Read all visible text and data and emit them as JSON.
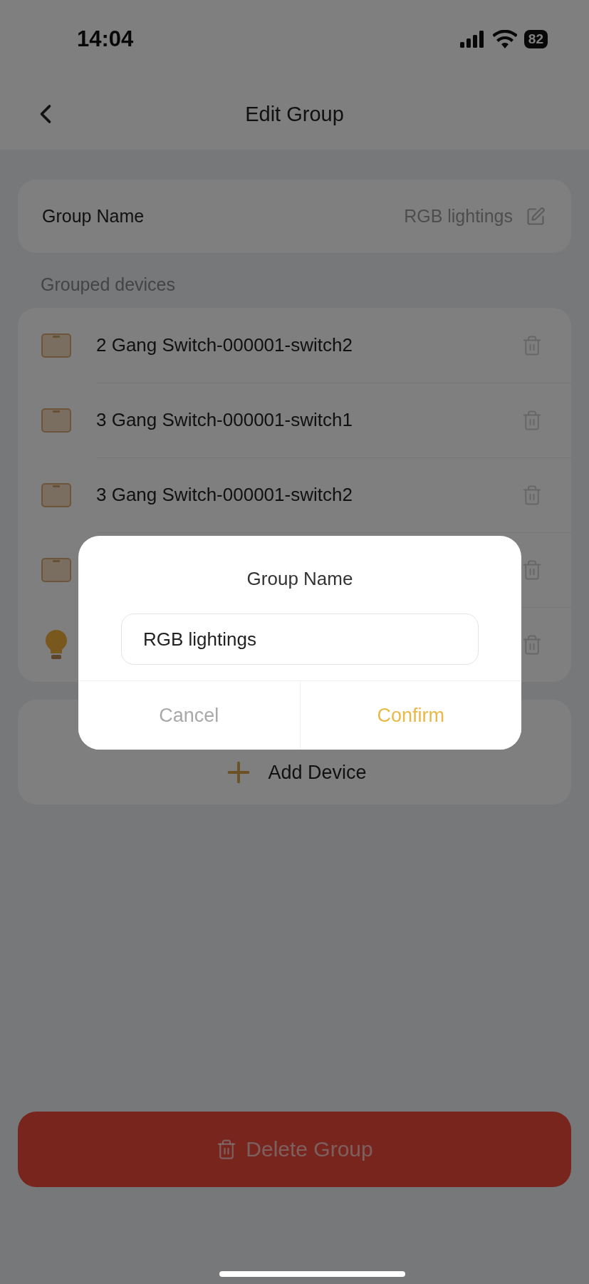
{
  "status_bar": {
    "time": "14:04",
    "battery": "82"
  },
  "header": {
    "title": "Edit Group"
  },
  "group_name": {
    "label": "Group Name",
    "value": "RGB lightings"
  },
  "devices_heading": "Grouped devices",
  "devices": [
    {
      "kind": "switch",
      "name": "2 Gang Switch-000001-switch2"
    },
    {
      "kind": "switch",
      "name": "3 Gang Switch-000001-switch1"
    },
    {
      "kind": "switch",
      "name": "3 Gang Switch-000001-switch2"
    },
    {
      "kind": "switch"
    },
    {
      "kind": "bulb"
    }
  ],
  "add_device": {
    "label": "Add Device"
  },
  "delete_button": {
    "label": "Delete Group"
  },
  "dialog": {
    "title": "Group Name",
    "value": "RGB lightings",
    "buttons": [
      {
        "kind": "cancel",
        "label": "Cancel"
      },
      {
        "kind": "confirm",
        "label": "Confirm"
      }
    ]
  }
}
